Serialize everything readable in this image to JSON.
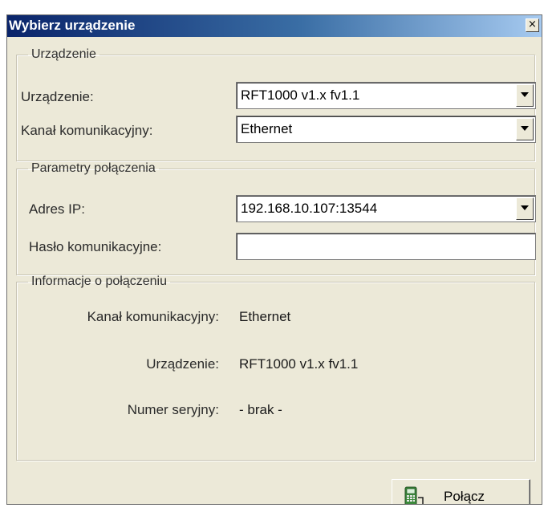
{
  "window": {
    "title": "Wybierz urządzenie",
    "close_glyph": "×"
  },
  "device_group": {
    "legend": "Urządzenie",
    "device_label": "Urządzenie:",
    "device_value": "RFT1000 v1.x fv1.1",
    "channel_label": "Kanał komunikacyjny:",
    "channel_value": "Ethernet"
  },
  "connection_params": {
    "legend": "Parametry połączenia",
    "ip_label": "Adres IP:",
    "ip_value": "192.168.10.107:13544",
    "password_label": "Hasło komunikacyjne:",
    "password_value": ""
  },
  "connection_info": {
    "legend": "Informacje o połączeniu",
    "channel_label": "Kanał komunikacyjny:",
    "channel_value": "Ethernet",
    "device_label": "Urządzenie:",
    "device_value": "RFT1000 v1.x fv1.1",
    "serial_label": "Numer seryjny:",
    "serial_value": "- brak -"
  },
  "actions": {
    "connect_label": "Połącz",
    "connect_icon": "device-connect-icon"
  }
}
